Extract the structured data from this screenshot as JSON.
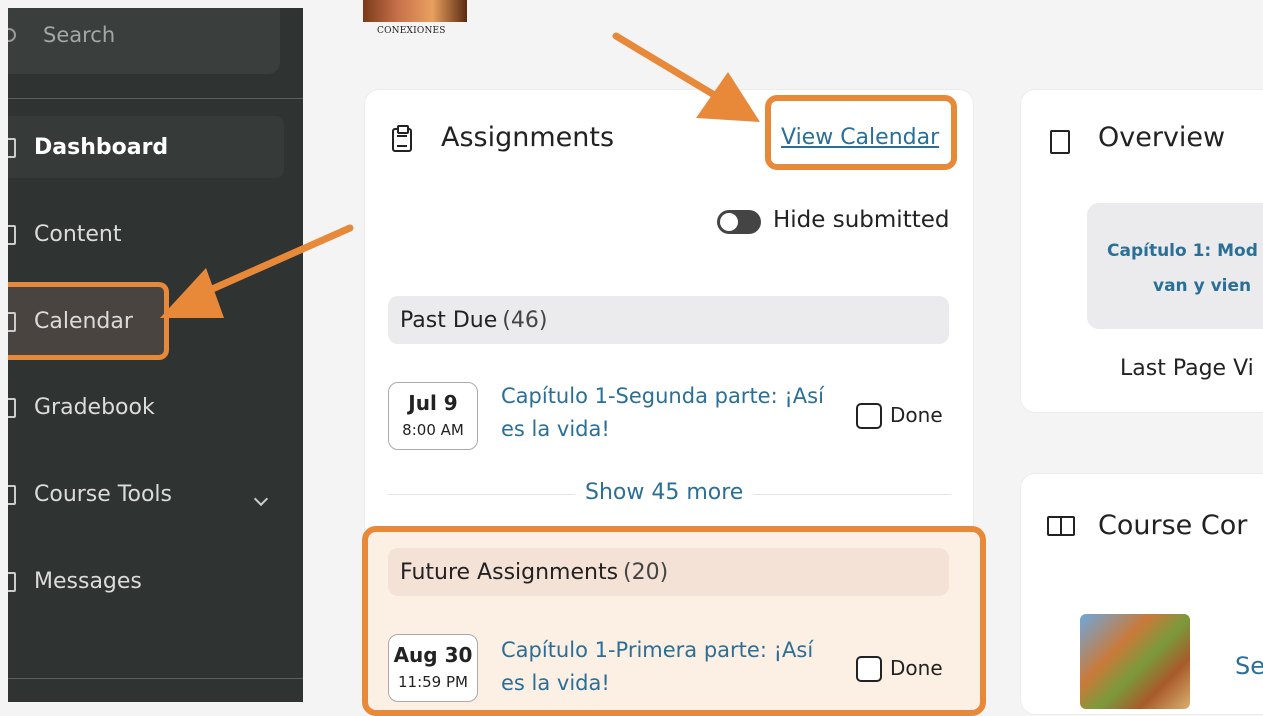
{
  "sidebar": {
    "search_placeholder": "Search",
    "items": [
      {
        "label": "Dashboard"
      },
      {
        "label": "Content"
      },
      {
        "label": "Calendar"
      },
      {
        "label": "Gradebook"
      },
      {
        "label": "Course Tools"
      },
      {
        "label": "Messages"
      }
    ]
  },
  "logo_text": "CONEXIONES",
  "assignments": {
    "title": "Assignments",
    "view_calendar": "View Calendar",
    "hide_submitted": "Hide submitted",
    "past_due": {
      "label": "Past Due",
      "count": "(46)",
      "items": [
        {
          "date": "Jul 9",
          "time": "8:00 AM",
          "title": "Capítulo 1-Segunda parte: ¡Así es la vida!",
          "done_label": "Done"
        }
      ]
    },
    "show_more": "Show 45 more",
    "future": {
      "label": "Future Assignments",
      "count": "(20)",
      "items": [
        {
          "date": "Aug 30",
          "time": "11:59 PM",
          "title": "Capítulo 1-Primera parte: ¡Así es la vida!",
          "done_label": "Done"
        }
      ]
    }
  },
  "overview": {
    "title": "Overview",
    "link_line1": "Capítulo 1: Mod",
    "link_line2": "van y vien",
    "last_page": "Last Page Vi"
  },
  "course_content": {
    "title": "Course Cor",
    "link_partial": "Se"
  },
  "colors": {
    "highlight": "#e8893a",
    "link": "#2a6f97",
    "sidebar_bg": "#2f3331"
  }
}
